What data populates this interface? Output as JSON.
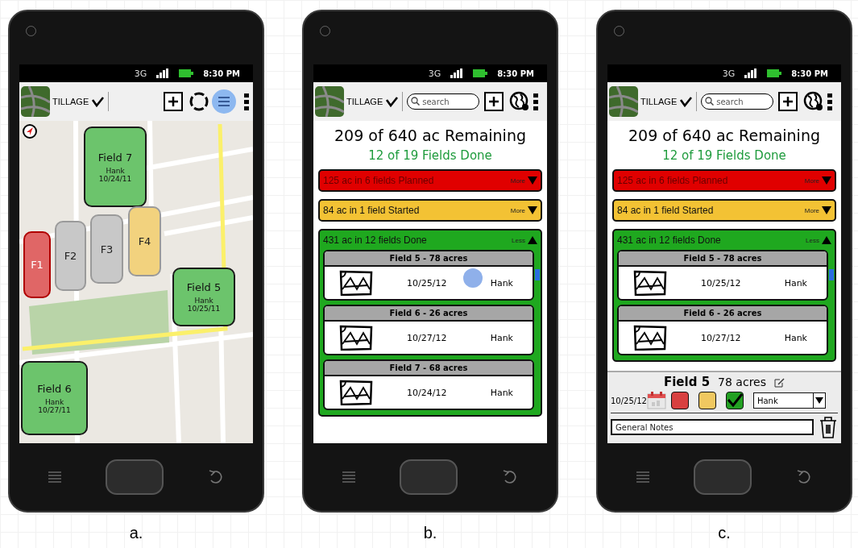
{
  "phones": [
    {
      "kind": "map",
      "caption": "a.",
      "network": "3G",
      "time": "8:30 PM",
      "app_title": "TILLAGE",
      "list_view_selected": true,
      "fields": [
        {
          "label": "Field 7",
          "operator": "Hank",
          "date": "10/24/11",
          "color": "#6cc46c"
        },
        {
          "label": "F1",
          "color": "#e06666"
        },
        {
          "label": "F2",
          "color": "#c8c8c8"
        },
        {
          "label": "F3",
          "color": "#c8c8c8"
        },
        {
          "label": "F4",
          "color": "#f2d27e"
        },
        {
          "label": "Field 5",
          "operator": "Hank",
          "date": "10/25/11",
          "color": "#6cc46c"
        },
        {
          "label": "Field 6",
          "operator": "Hank",
          "date": "10/27/11",
          "color": "#6cc46c"
        }
      ]
    },
    {
      "kind": "list",
      "caption": "b.",
      "network": "3G",
      "time": "8:30 PM",
      "app_title": "TILLAGE",
      "search": {
        "placeholder": "search"
      },
      "remaining": "209 of 640 ac Remaining",
      "done_count": "12 of 19 Fields Done",
      "groups": [
        {
          "text": "125 ac in 6 fields Planned",
          "toggle": "More",
          "expanded": false,
          "color": "#e00000"
        },
        {
          "text": "84 ac in 1 field Started",
          "toggle": "More",
          "expanded": false,
          "color": "#f3c234"
        },
        {
          "text": "431 ac in 12 fields Done",
          "toggle": "Less",
          "expanded": true,
          "color": "#1fa81f",
          "items": [
            {
              "title": "Field 5 - 78 acres",
              "date": "10/25/12",
              "operator": "Hank",
              "touched": true
            },
            {
              "title": "Field 6 - 26 acres",
              "date": "10/27/12",
              "operator": "Hank",
              "touched": false
            },
            {
              "title": "Field 7 - 68 acres",
              "date": "10/24/12",
              "operator": "Hank",
              "touched": false
            }
          ]
        }
      ]
    },
    {
      "kind": "list",
      "caption": "c.",
      "network": "3G",
      "time": "8:30 PM",
      "app_title": "TILLAGE",
      "search": {
        "placeholder": "search"
      },
      "remaining": "209 of 640 ac Remaining",
      "done_count": "12 of 19 Fields Done",
      "groups": [
        {
          "text": "125 ac in 6 fields Planned",
          "toggle": "More",
          "expanded": false,
          "color": "#e00000"
        },
        {
          "text": "84 ac in 1 field Started",
          "toggle": "More",
          "expanded": false,
          "color": "#f3c234"
        },
        {
          "text": "431 ac in 12 fields Done",
          "toggle": "Less",
          "expanded": true,
          "color": "#1fa81f",
          "items": [
            {
              "title": "Field 5 - 78 acres",
              "date": "10/25/12",
              "operator": "Hank",
              "touched": false
            },
            {
              "title": "Field 6 - 26 acres",
              "date": "10/27/12",
              "operator": "Hank",
              "touched": false
            }
          ]
        }
      ],
      "detail": {
        "title": "Field 5",
        "acres": "78 acres",
        "date": "10/25/12",
        "statuses": [
          {
            "color": "#d84040",
            "checked": false
          },
          {
            "color": "#f0c860",
            "checked": false
          },
          {
            "color": "#22a022",
            "checked": true
          }
        ],
        "operator": "Hank",
        "notes": {
          "placeholder": "General Notes"
        }
      }
    }
  ]
}
